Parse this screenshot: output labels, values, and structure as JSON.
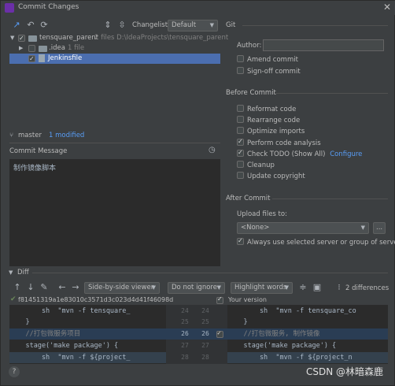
{
  "window": {
    "title": "Commit Changes"
  },
  "toolbar": {
    "changelist_label": "Changelist:",
    "changelist_value": "Default"
  },
  "tree": {
    "root_name": "tensquare_parent",
    "root_meta": "2 files  D:\\IdeaProjects\\tensquare_parent",
    "idea_name": ".idea",
    "idea_meta": "1 file",
    "file_name": "Jenkinsfile"
  },
  "status": {
    "branch": "master",
    "modified": "1 modified"
  },
  "commit_message": {
    "label": "Commit Message",
    "text": "制作镜像脚本"
  },
  "git": {
    "section": "Git",
    "author_label": "Author:",
    "author_value": "",
    "amend": "Amend commit",
    "signoff": "Sign-off commit"
  },
  "before_commit": {
    "section": "Before Commit",
    "items": [
      {
        "label": "Reformat code",
        "checked": false
      },
      {
        "label": "Rearrange code",
        "checked": false
      },
      {
        "label": "Optimize imports",
        "checked": false
      },
      {
        "label": "Perform code analysis",
        "checked": true
      },
      {
        "label": "Check TODO (Show All)",
        "checked": true,
        "link": "Configure"
      },
      {
        "label": "Cleanup",
        "checked": false
      },
      {
        "label": "Update copyright",
        "checked": false
      }
    ]
  },
  "after_commit": {
    "section": "After Commit",
    "upload_label": "Upload files to:",
    "upload_value": "<None>",
    "browse_label": "...",
    "always_use": "Always use selected server or group of servers"
  },
  "diff": {
    "label": "Diff",
    "viewer": "Side-by-side viewer",
    "ignore": "Do not ignore",
    "highlight": "Highlight words",
    "differences": "2 differences",
    "left_revision": "f81451319a1e83010c3571d3c023d4d41f46098d",
    "right_revision": "Your version",
    "left_lines": [
      "        sh  \"mvn -f tensquare_",
      "    }",
      "    //打包微服务项目",
      "    stage('make package') {",
      "        sh  \"mvn -f ${project_"
    ],
    "right_lines": [
      "        sh  \"mvn -f tensquare_co",
      "    }",
      "    //打包微服务, 制作镜像",
      "    stage('make package') {",
      "        sh  \"mvn -f ${project_n"
    ],
    "gutter_left": [
      "24",
      "25",
      "26",
      "27",
      "28"
    ],
    "gutter_right": [
      "24",
      "25",
      "26",
      "27",
      "28"
    ]
  },
  "watermark": "CSDN @林暗森鹿",
  "help": "?"
}
